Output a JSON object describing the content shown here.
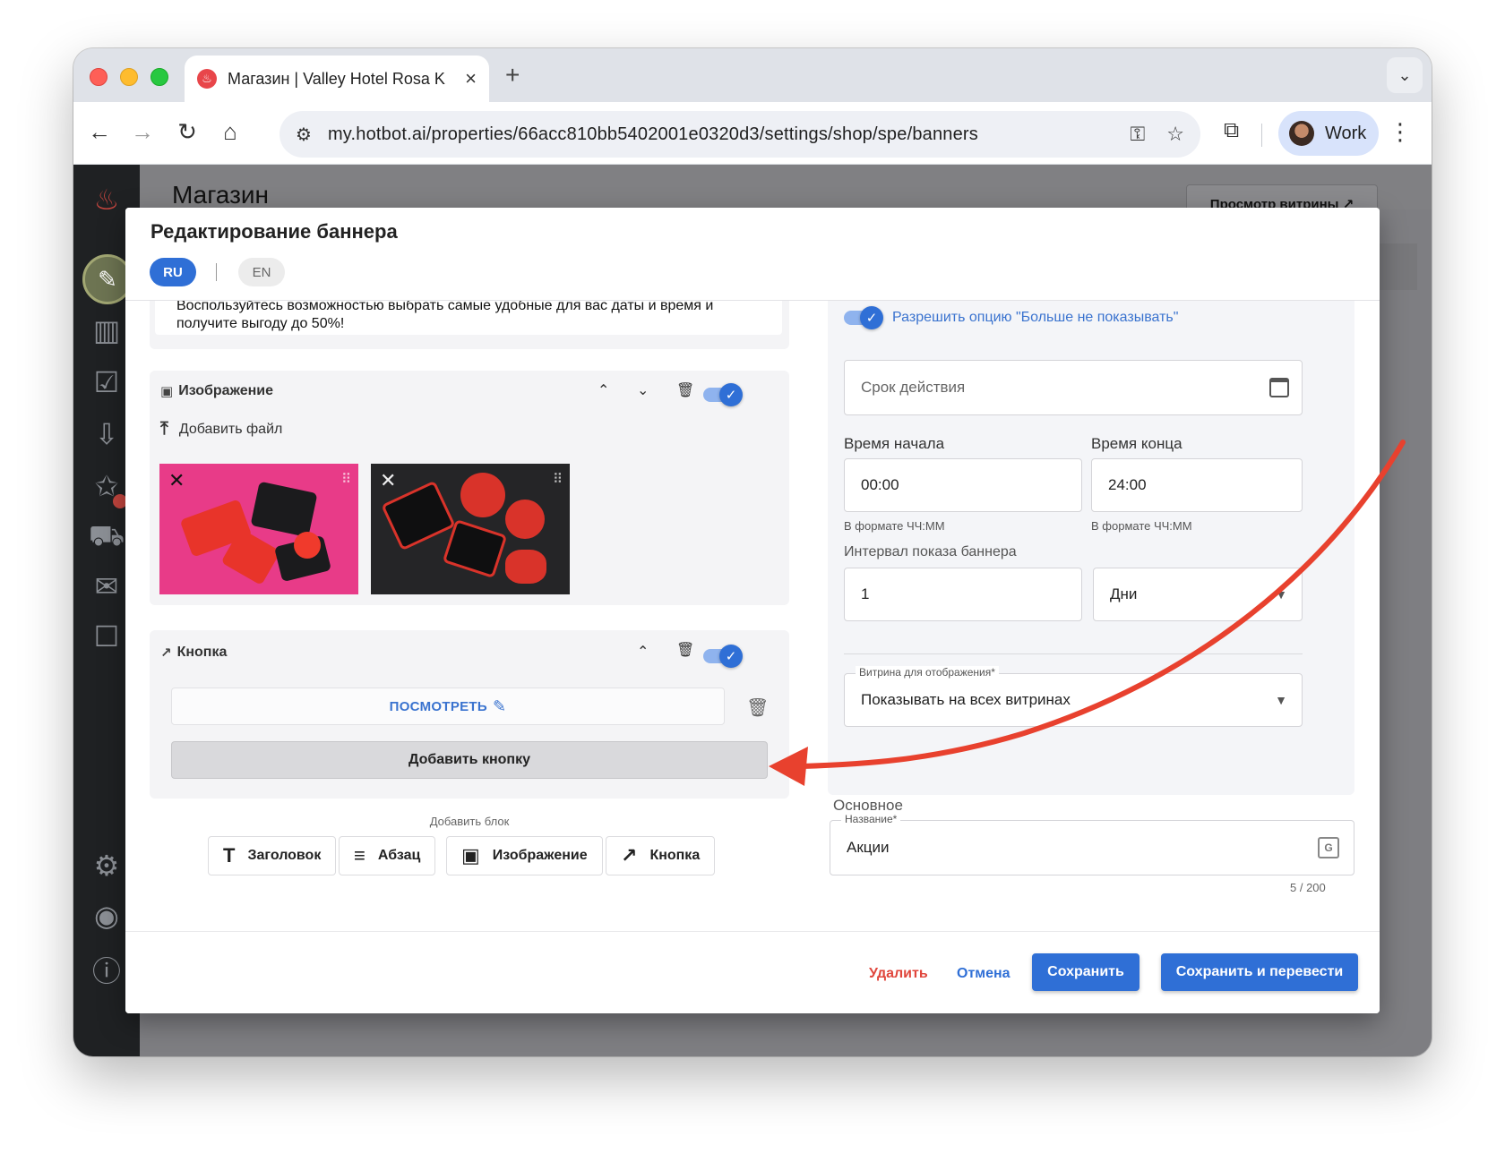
{
  "browser": {
    "tab_title": "Магазин | Valley Hotel Rosa K",
    "url": "my.hotbot.ai/properties/66acc810bb5402001e0320d3/settings/shop/spe/banners",
    "profile_label": "Work"
  },
  "page": {
    "title": "Магазин",
    "preview_button": "Просмотр витрины ↗"
  },
  "modal": {
    "title": "Редактирование баннера",
    "lang_ru": "RU",
    "lang_en": "EN",
    "text_block": {
      "content": "Воспользуйтесь возможностью выбрать самые удобные для вас даты и время и получите выгоду до 50%!"
    },
    "image_block": {
      "title": "Изображение",
      "add_file": "Добавить файл"
    },
    "button_block": {
      "title": "Кнопка",
      "item_label": "ПОСМОТРЕТЬ",
      "add_button": "Добавить кнопку"
    },
    "add_block": {
      "label": "Добавить блок",
      "options": [
        "Заголовок",
        "Абзац",
        "Изображение",
        "Кнопка"
      ]
    },
    "settings": {
      "allow_dont_show": "Разрешить опцию \"Больше не показывать\"",
      "validity_placeholder": "Срок действия",
      "start_label": "Время начала",
      "start_value": "00:00",
      "start_hint": "В формате ЧЧ:ММ",
      "end_label": "Время конца",
      "end_value": "24:00",
      "end_hint": "В формате ЧЧ:ММ",
      "interval_label": "Интервал показа баннера",
      "interval_value": "1",
      "interval_unit": "Дни",
      "showcase_legend": "Витрина для отображения*",
      "showcase_value": "Показывать на всех витринах"
    },
    "main": {
      "section_label": "Основное",
      "name_legend": "Название*",
      "name_value": "Акции",
      "char_count": "5 / 200"
    },
    "footer": {
      "delete": "Удалить",
      "cancel": "Отмена",
      "save": "Сохранить",
      "save_translate": "Сохранить и перевести"
    }
  },
  "colors": {
    "accent": "#2f6fd6",
    "danger": "#e0463c",
    "annotation_arrow": "#e8412e"
  }
}
